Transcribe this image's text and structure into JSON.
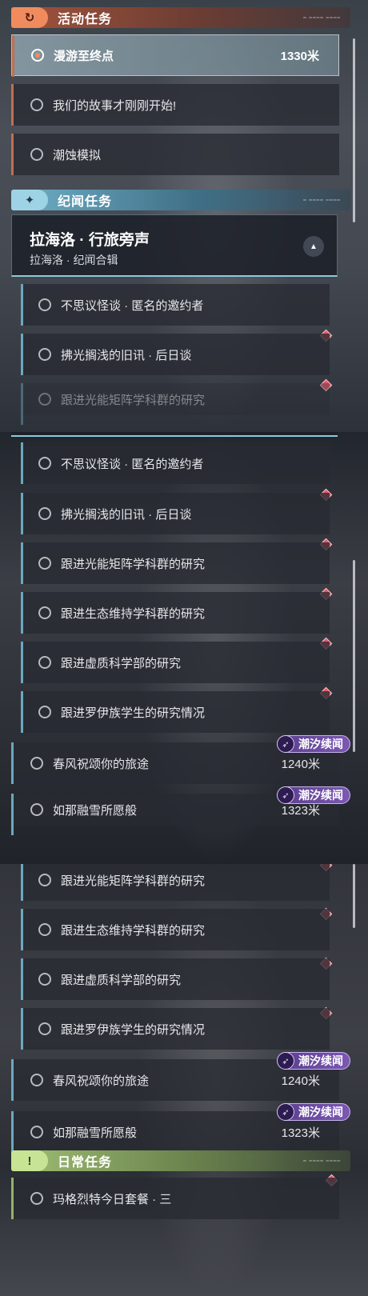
{
  "headers": {
    "activity": {
      "title": "活动任务",
      "icon": "refresh-icon",
      "accent": "#f08b5e"
    },
    "story": {
      "title": "纪闻任务",
      "icon": "star-icon",
      "accent": "#9ed3e6"
    },
    "daily": {
      "title": "日常任务",
      "icon": "exclamation-icon",
      "accent": "#c7e494"
    }
  },
  "activity_tasks": [
    {
      "label": "漫游至终点",
      "distance": "1330米",
      "active": true
    },
    {
      "label": "我们的故事才刚刚开始!"
    },
    {
      "label": "潮蚀模拟"
    }
  ],
  "story_group": {
    "title": "拉海洛 · 行旅旁声",
    "subtitle": "拉海洛 · 纪闻合辑"
  },
  "story_tasks": [
    {
      "label": "不思议怪谈 · 匿名的邀约者"
    },
    {
      "label": "拂光搁浅的旧讯 · 后日谈"
    },
    {
      "label": "跟进光能矩阵学科群的研究"
    },
    {
      "label": "跟进生态维持学科群的研究"
    },
    {
      "label": "跟进虚质科学部的研究"
    },
    {
      "label": "跟进罗伊族学生的研究情况"
    }
  ],
  "tide_tasks": [
    {
      "label": "春风祝颂你的旅途",
      "distance": "1240米",
      "tag": "潮汐续闻"
    },
    {
      "label": "如那融雪所愿般",
      "distance": "1323米",
      "tag": "潮汐续闻"
    }
  ],
  "daily_tasks": [
    {
      "label": "玛格烈特今日套餐 · 三"
    }
  ]
}
